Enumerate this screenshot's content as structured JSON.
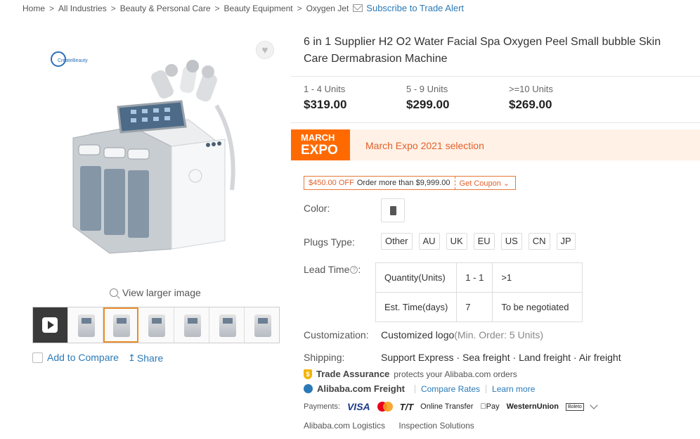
{
  "breadcrumb": {
    "items": [
      "Home",
      "All Industries",
      "Beauty & Personal Care",
      "Beauty Equipment",
      "Oxygen Jet"
    ],
    "subscribe": "Subscribe to Trade Alert"
  },
  "gallery": {
    "logo_text": "CreateBeauty",
    "view_larger": "View larger image",
    "add_to_compare": "Add to Compare",
    "share": "Share"
  },
  "product": {
    "title": "6 in 1 Supplier H2 O2 Water Facial Spa Oxygen Peel Small bubble Skin Care Dermabrasion Machine",
    "price_tiers": [
      {
        "qty": "1 - 4 Units",
        "price": "$319.00"
      },
      {
        "qty": "5 - 9 Units",
        "price": "$299.00"
      },
      {
        "qty": ">=10 Units",
        "price": "$269.00"
      }
    ],
    "expo": {
      "badge_line1": "MARCH",
      "badge_line2": "EXPO",
      "text": "March Expo 2021 selection"
    },
    "coupon": {
      "off": "$450.00 OFF",
      "condition": "Order more than $9,999.00",
      "get": "Get Coupon"
    },
    "labels": {
      "color": "Color:",
      "plugs": "Plugs Type:",
      "lead_time": "Lead Time",
      "customization": "Customization:",
      "shipping": "Shipping:"
    },
    "plugs": [
      "Other",
      "AU",
      "UK",
      "EU",
      "US",
      "CN",
      "JP"
    ],
    "lead_time_table": {
      "row1": [
        "Quantity(Units)",
        "1 - 1",
        ">1"
      ],
      "row2": [
        "Est. Time(days)",
        "7",
        "To be negotiated"
      ]
    },
    "customization": {
      "value": "Customized logo",
      "min_order": "(Min. Order: 5 Units)"
    },
    "shipping": "Support Express · Sea freight · Land freight · Air freight",
    "trade_assurance": {
      "brand": "Trade Assurance",
      "text": "protects your Alibaba.com orders"
    },
    "freight": {
      "brand": "Alibaba.com Freight",
      "compare": "Compare Rates",
      "learn": "Learn more"
    },
    "payments": {
      "label": "Payments:",
      "methods": [
        "VISA",
        "T/T",
        "Online Transfer",
        "Pay",
        "WesternUnion",
        "Boleto"
      ]
    },
    "footer_links": [
      "Alibaba.com Logistics",
      "Inspection Solutions"
    ]
  },
  "colors": {
    "accent": "#ff6a00",
    "link": "#2a7ab8",
    "expo_bg": "#fff1e6"
  }
}
